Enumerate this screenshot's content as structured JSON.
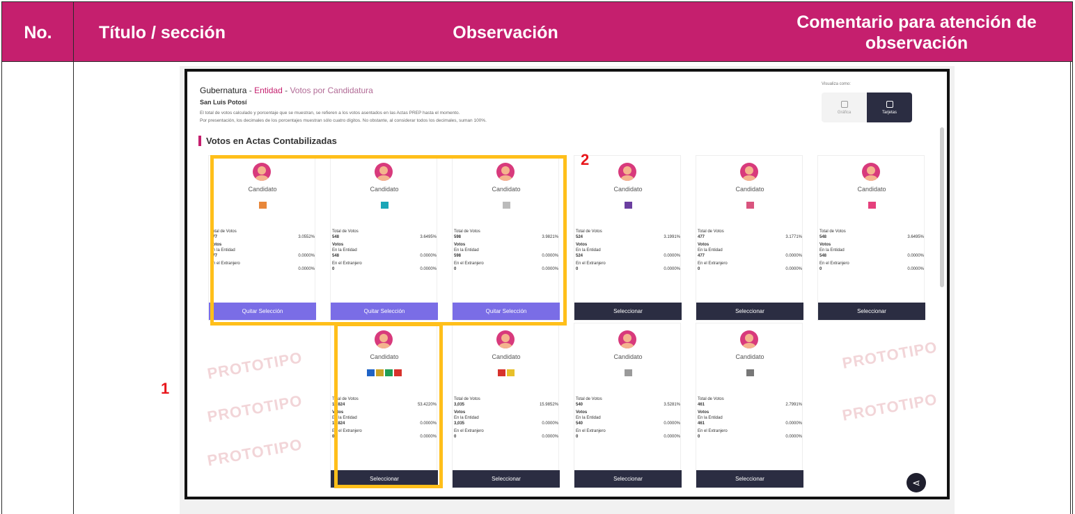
{
  "table": {
    "headers": [
      "No.",
      "Título / sección",
      "Observación",
      "Comentario para atención de observación"
    ]
  },
  "markers": [
    "1",
    "2"
  ],
  "screenshot": {
    "breadcrumb": {
      "level1": "Gubernatura",
      "sep1": " - ",
      "level2": "Entidad",
      "sep2": " - ",
      "level3": "Votos por Candidatura"
    },
    "state": "San Luis Potosí",
    "note_line1": "El total de votos calculado y porcentaje que se muestran, se refieren a los votos asentados en las Actas PREP hasta el momento.",
    "note_line2": "Por presentación, los decimales de los porcentajes muestran sólo cuatro dígitos. No obstante, al considerar todos los decimales, suman 100%.",
    "section_title": "Votos en Actas Contabilizadas",
    "view_label": "Visualiza como:",
    "view_options": [
      "Gráfica",
      "Tarjetas"
    ],
    "watermark": "PROTOTIPO",
    "cards": [
      {
        "name": "Candidato",
        "total_label": "Total de Votos",
        "total": "477",
        "pct": "3.0552%",
        "votos_label": "Votos",
        "entidad_label": "En la Entidad",
        "entidad": "477",
        "entidad_pct": "0.0000%",
        "extranjero_label": "En el Extranjero",
        "extranjero": "0",
        "extranjero_pct": "0.0000%",
        "button": "Quitar Selección",
        "selected": true,
        "logo_colors": [
          "#e8873a"
        ]
      },
      {
        "name": "Candidato",
        "total_label": "Total de Votos",
        "total": "548",
        "pct": "3.6495%",
        "votos_label": "Votos",
        "entidad_label": "En la Entidad",
        "entidad": "548",
        "entidad_pct": "0.0000%",
        "extranjero_label": "En el Extranjero",
        "extranjero": "0",
        "extranjero_pct": "0.0000%",
        "button": "Quitar Selección",
        "selected": true,
        "logo_colors": [
          "#1aa6b7"
        ]
      },
      {
        "name": "Candidato",
        "total_label": "Total de Votos",
        "total": "598",
        "pct": "3.9821%",
        "votos_label": "Votos",
        "entidad_label": "En la Entidad",
        "entidad": "598",
        "entidad_pct": "0.0000%",
        "extranjero_label": "En el Extranjero",
        "extranjero": "0",
        "extranjero_pct": "0.0000%",
        "button": "Quitar Selección",
        "selected": true,
        "logo_colors": [
          "#bbbbbb"
        ]
      },
      {
        "name": "Candidato",
        "total_label": "Total de Votos",
        "total": "524",
        "pct": "3.1991%",
        "votos_label": "Votos",
        "entidad_label": "En la Entidad",
        "entidad": "524",
        "entidad_pct": "0.0000%",
        "extranjero_label": "En el Extranjero",
        "extranjero": "0",
        "extranjero_pct": "0.0000%",
        "button": "Seleccionar",
        "selected": false,
        "logo_colors": [
          "#6b3fa0"
        ]
      },
      {
        "name": "Candidato",
        "total_label": "Total de Votos",
        "total": "477",
        "pct": "3.1771%",
        "votos_label": "Votos",
        "entidad_label": "En la Entidad",
        "entidad": "477",
        "entidad_pct": "0.0000%",
        "extranjero_label": "En el Extranjero",
        "extranjero": "0",
        "extranjero_pct": "0.0000%",
        "button": "Seleccionar",
        "selected": false,
        "logo_colors": [
          "#d9547e"
        ]
      },
      {
        "name": "Candidato",
        "total_label": "Total de Votos",
        "total": "548",
        "pct": "3.6495%",
        "votos_label": "Votos",
        "entidad_label": "En la Entidad",
        "entidad": "548",
        "entidad_pct": "0.0000%",
        "extranjero_label": "En el Extranjero",
        "extranjero": "0",
        "extranjero_pct": "0.0000%",
        "button": "Seleccionar",
        "selected": false,
        "logo_colors": [
          "#e5407c"
        ]
      },
      {
        "name": "Candidato",
        "total_label": "Total de Votos",
        "total": "12,824",
        "pct": "53.4220%",
        "votos_label": "Votos",
        "entidad_label": "En la Entidad",
        "entidad": "12,824",
        "entidad_pct": "0.0000%",
        "extranjero_label": "En el Extranjero",
        "extranjero": "0",
        "extranjero_pct": "0.0000%",
        "button": "Seleccionar",
        "selected": false,
        "logo_colors": [
          "#1f63c6",
          "#c9a227",
          "#1f9e55",
          "#d7322c"
        ]
      },
      {
        "name": "Candidato",
        "total_label": "Total de Votos",
        "total": "3,035",
        "pct": "15.9852%",
        "votos_label": "Votos",
        "entidad_label": "En la Entidad",
        "entidad": "3,035",
        "entidad_pct": "0.0000%",
        "extranjero_label": "En el Extranjero",
        "extranjero": "0",
        "extranjero_pct": "0.0000%",
        "button": "Seleccionar",
        "selected": false,
        "logo_colors": [
          "#d7322c",
          "#e8c02a"
        ]
      },
      {
        "name": "Candidato",
        "total_label": "Total de Votos",
        "total": "540",
        "pct": "3.5281%",
        "votos_label": "Votos",
        "entidad_label": "En la Entidad",
        "entidad": "540",
        "entidad_pct": "0.0000%",
        "extranjero_label": "En el Extranjero",
        "extranjero": "0",
        "extranjero_pct": "0.0000%",
        "button": "Seleccionar",
        "selected": false,
        "logo_colors": [
          "#9a9a9a"
        ]
      },
      {
        "name": "Candidato",
        "total_label": "Total de Votos",
        "total": "461",
        "pct": "2.7991%",
        "votos_label": "Votos",
        "entidad_label": "En la Entidad",
        "entidad": "461",
        "entidad_pct": "0.0000%",
        "extranjero_label": "En el Extranjero",
        "extranjero": "0",
        "extranjero_pct": "0.0000%",
        "button": "Seleccionar",
        "selected": false,
        "logo_colors": [
          "#777777"
        ]
      }
    ]
  }
}
